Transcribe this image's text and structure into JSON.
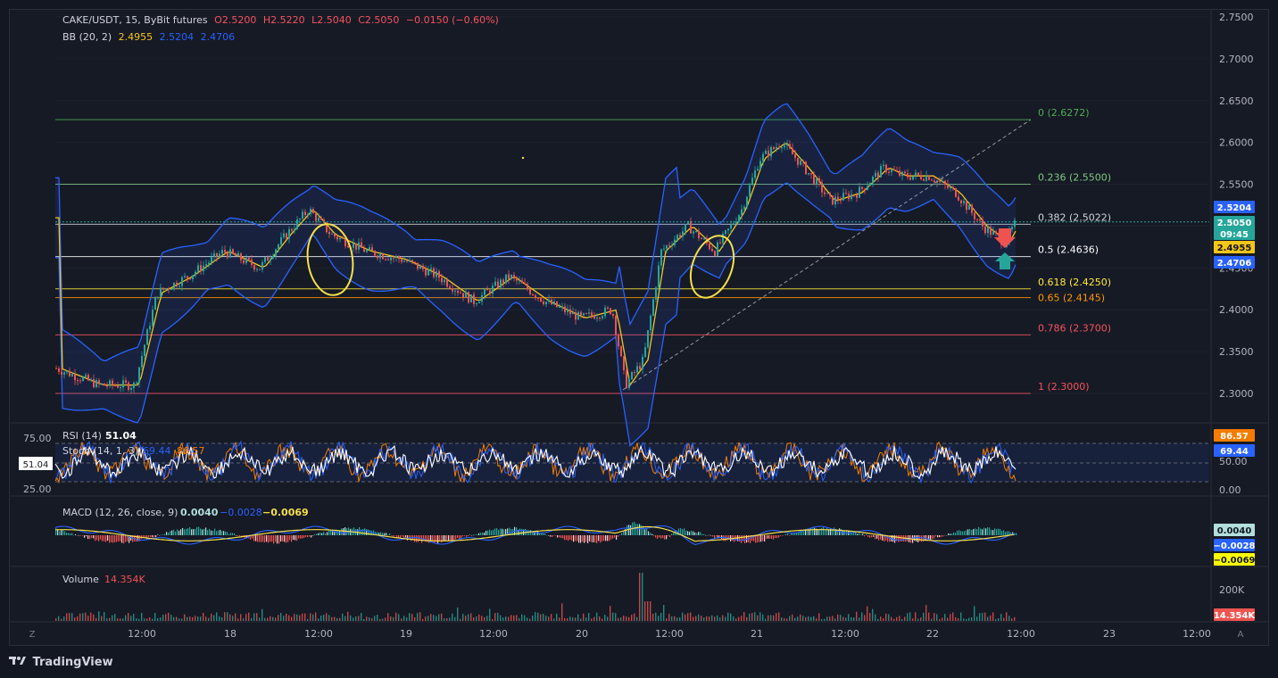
{
  "header": {
    "symbol": "CAKE/USDT, 15, ByBit futures",
    "open": "O2.5200",
    "high": "H2.5220",
    "low": "L2.5040",
    "close": "C2.5050",
    "change": "−0.0150 (−0.60%)"
  },
  "bb": {
    "label": "BB (20, 2)",
    "basis": "2.4955",
    "upper": "2.5204",
    "lower": "2.4706"
  },
  "rsi": {
    "label": "RSI (14)",
    "value": "51.04",
    "stoch_label": "Stoch (14, 1, 3)",
    "stoch_k": "69.44",
    "stoch_d": "86.57"
  },
  "macd": {
    "label": "MACD (12, 26, close, 9)",
    "hist": "0.0040",
    "macd": "−0.0028",
    "signal": "−0.0069"
  },
  "volume": {
    "label": "Volume",
    "value": "14.354K"
  },
  "price_tags": {
    "upper": "2.5204",
    "last": "2.5050",
    "countdown": "09:45",
    "basis": "2.4955",
    "lower": "2.4706"
  },
  "fib_levels": [
    {
      "label": "0 (2.6272)",
      "price": 2.6272,
      "color": "#4caf50"
    },
    {
      "label": "0.236 (2.5500)",
      "price": 2.55,
      "color": "#81c784"
    },
    {
      "label": "0.382 (2.5022)",
      "price": 2.5022,
      "color": "#d1d4dc"
    },
    {
      "label": "0.5 (2.4636)",
      "price": 2.4636,
      "color": "#ffffff"
    },
    {
      "label": "0.618 (2.4250)",
      "price": 2.425,
      "color": "#ffeb3b"
    },
    {
      "label": "0.65 (2.4145)",
      "price": 2.4145,
      "color": "#ff9800"
    },
    {
      "label": "0.786 (2.3700)",
      "price": 2.37,
      "color": "#f7525f"
    },
    {
      "label": "1 (2.3000)",
      "price": 2.3,
      "color": "#f7525f"
    }
  ],
  "price_axis": [
    "2.7500",
    "2.7000",
    "2.6500",
    "2.6000",
    "2.5500",
    "2.5000",
    "2.4500",
    "2.4000",
    "2.3500",
    "2.3000"
  ],
  "rsi_axis": [
    "75.00",
    "25.00"
  ],
  "stoch_axis": [
    "50.00",
    "0.00"
  ],
  "rsi_tag": "51.04",
  "stoch_tags": {
    "d": "86.57",
    "k": "69.44"
  },
  "macd_tags": {
    "hist": "0.0040",
    "macd": "−0.0028",
    "signal": "−0.0069"
  },
  "vol_axis": "200K",
  "vol_tag": "14.354K",
  "time_axis": [
    "12:00",
    "18",
    "12:00",
    "19",
    "12:00",
    "20",
    "12:00",
    "21",
    "12:00",
    "22",
    "12:00",
    "23",
    "12:00"
  ],
  "footer": {
    "brand": "TradingView",
    "z_label": "Z",
    "a_label": "A"
  },
  "chart_data": {
    "type": "line",
    "title": "CAKE/USDT, 15, ByBit futures",
    "ylim": [
      2.27,
      2.755
    ],
    "x": [
      "17 06:00",
      "17 12:00",
      "17 18:00",
      "18 00:00",
      "18 06:00",
      "18 12:00",
      "18 18:00",
      "19 00:00",
      "19 06:00",
      "19 12:00",
      "19 18:00",
      "20 00:00",
      "20 06:00",
      "20 12:00",
      "20 18:00",
      "21 00:00",
      "21 06:00",
      "21 12:00",
      "21 18:00",
      "22 00:00",
      "22 06:00",
      "22 10:00"
    ],
    "series": [
      {
        "values": [
          2.33,
          2.31,
          2.44,
          2.47,
          2.44,
          2.51,
          2.47,
          2.46,
          2.43,
          2.44,
          2.41,
          2.4,
          2.33,
          2.49,
          2.47,
          2.6,
          2.58,
          2.53,
          2.55,
          2.56,
          2.54,
          2.505
        ]
      }
    ]
  }
}
